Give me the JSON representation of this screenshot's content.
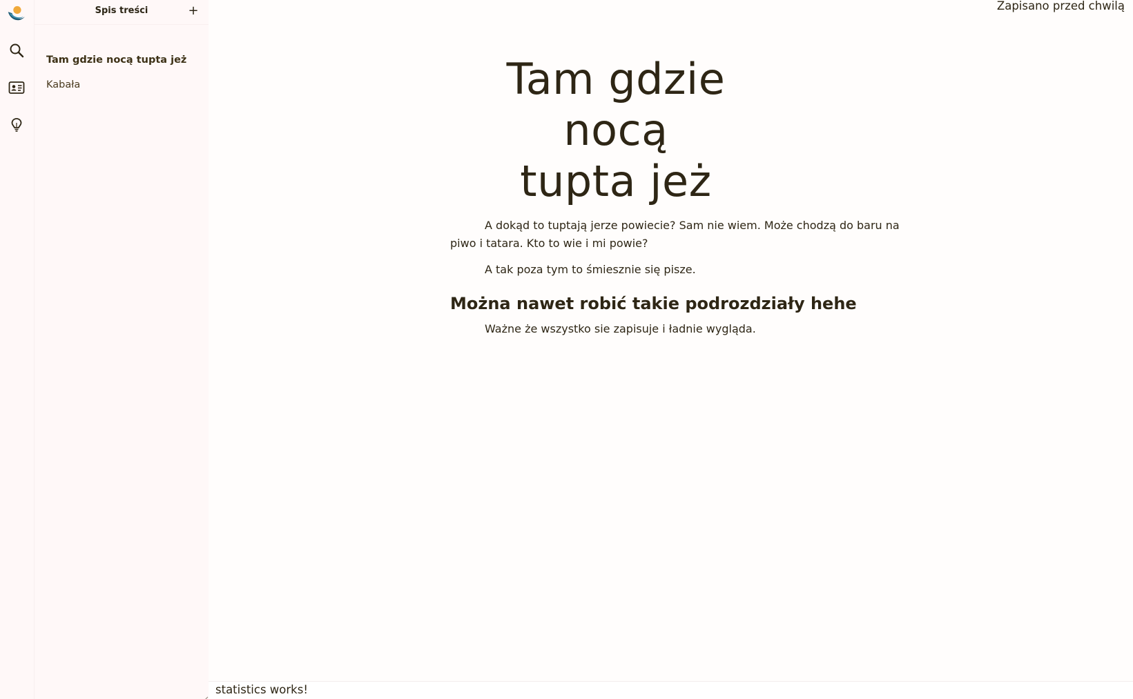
{
  "rail": {
    "icons": [
      "app-logo-icon",
      "search-icon",
      "contact-card-icon",
      "lightbulb-icon"
    ]
  },
  "sidebar": {
    "title": "Spis treści",
    "add_label": "+",
    "items": [
      {
        "label": "Tam gdzie nocą tupta jeż",
        "active": true
      },
      {
        "label": "Kabała",
        "active": false
      }
    ]
  },
  "main": {
    "save_status": "Zapisano przed chwilą",
    "title_line1": "Tam gdzie nocą",
    "title_line2": "tupta jeż",
    "paragraphs": [
      "A dokąd to tuptają jerze powiecie? Sam nie wiem. Może chodzą do baru na piwo i tatara. Kto to wie i mi powie?",
      "A tak poza tym to śmiesznie się pisze."
    ],
    "subheading": "Można nawet robić takie podrozdziały hehe",
    "paragraph_after": "Ważne że wszystko sie zapisuje i ładnie wygląda."
  },
  "statusbar": {
    "text": "statistics works!"
  },
  "colors": {
    "sidebar_bg": "#fff8f8",
    "text": "#2e2615",
    "logo_sun": "#f0a93b",
    "logo_wave": "#1f5a74"
  }
}
